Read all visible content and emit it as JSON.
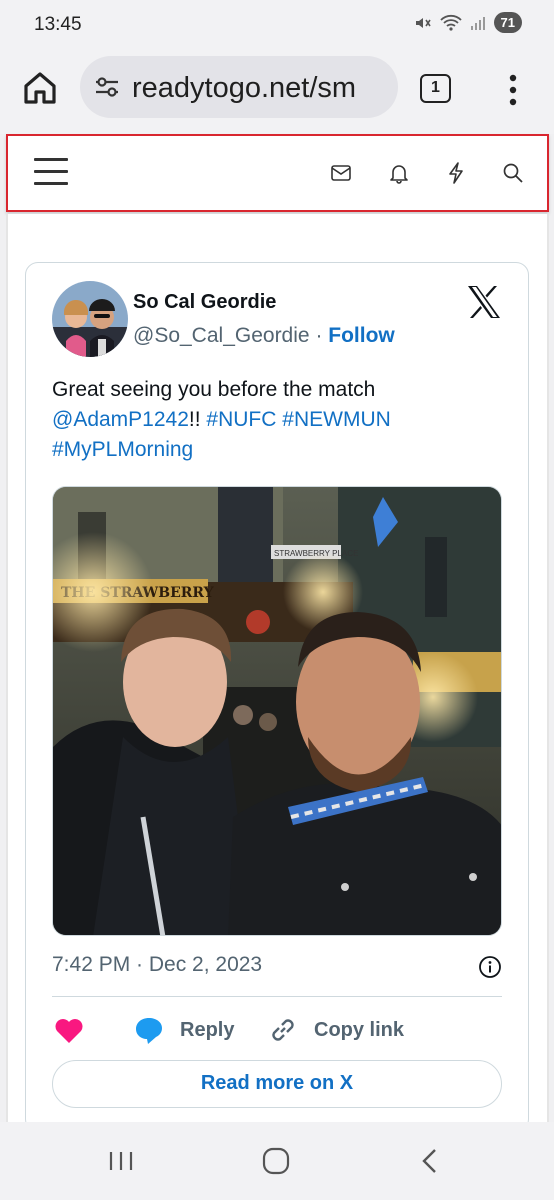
{
  "status": {
    "time": "13:45",
    "battery": "71"
  },
  "browser": {
    "url": "readytogo.net/sm",
    "tab_count": "1"
  },
  "tweet": {
    "author_name": "So Cal Geordie",
    "handle": "@So_Cal_Geordie",
    "separator": "·",
    "follow_label": "Follow",
    "text_prefix": "Great seeing you before the match",
    "mention": "@AdamP1242",
    "text_bang": "!!",
    "hashtags": [
      "#NUFC",
      "#NEWMUN",
      "#MyPLMorning"
    ],
    "timestamp": "7:42 PM · Dec 2, 2023",
    "reply_label": "Reply",
    "copy_link_label": "Copy link",
    "read_more_label": "Read more on X",
    "photo_signs": {
      "pub": "THE STRAWBERRY",
      "street": "STRAWBERRY PLACE"
    }
  },
  "colors": {
    "link": "#1270c4",
    "header_border": "#d9262f",
    "heart": "#f91880",
    "reply_bubble": "#1d9bf0"
  },
  "icons": [
    "home-icon",
    "site-settings-icon",
    "tabs-icon",
    "more-icon",
    "menu-icon",
    "mail-icon",
    "bell-icon",
    "bolt-icon",
    "search-icon",
    "x-logo-icon",
    "info-icon",
    "heart-icon",
    "reply-icon",
    "link-icon",
    "recents-icon",
    "home-nav-icon",
    "back-icon"
  ]
}
